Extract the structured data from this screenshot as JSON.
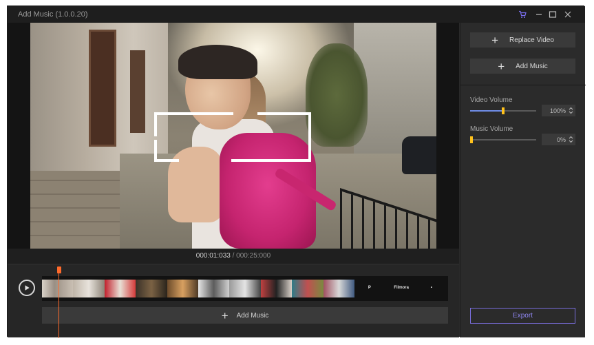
{
  "window": {
    "title": "Add Music (1.0.0.20)"
  },
  "titlebar_icons": [
    "cart-icon",
    "minimize-icon",
    "maximize-icon",
    "close-icon"
  ],
  "timecode": {
    "current": "000:01:033",
    "separator": " / ",
    "total": "000:25:000"
  },
  "timeline": {
    "add_music_label": "Add Music",
    "dark_thumbs": [
      "P",
      "Filmora",
      "•"
    ]
  },
  "panel": {
    "replace_video_label": "Replace Video",
    "add_music_label": "Add Music",
    "video_volume": {
      "label": "Video Volume",
      "value": "100%",
      "level": 0.5
    },
    "music_volume": {
      "label": "Music Volume",
      "value": "0%",
      "level": 0.0
    },
    "export_label": "Export"
  },
  "colors": {
    "accent": "#7b6fe0",
    "playhead": "#ff6a2b",
    "slider_fill": "#6f8de8",
    "slider_knob": "#ffc21c"
  }
}
